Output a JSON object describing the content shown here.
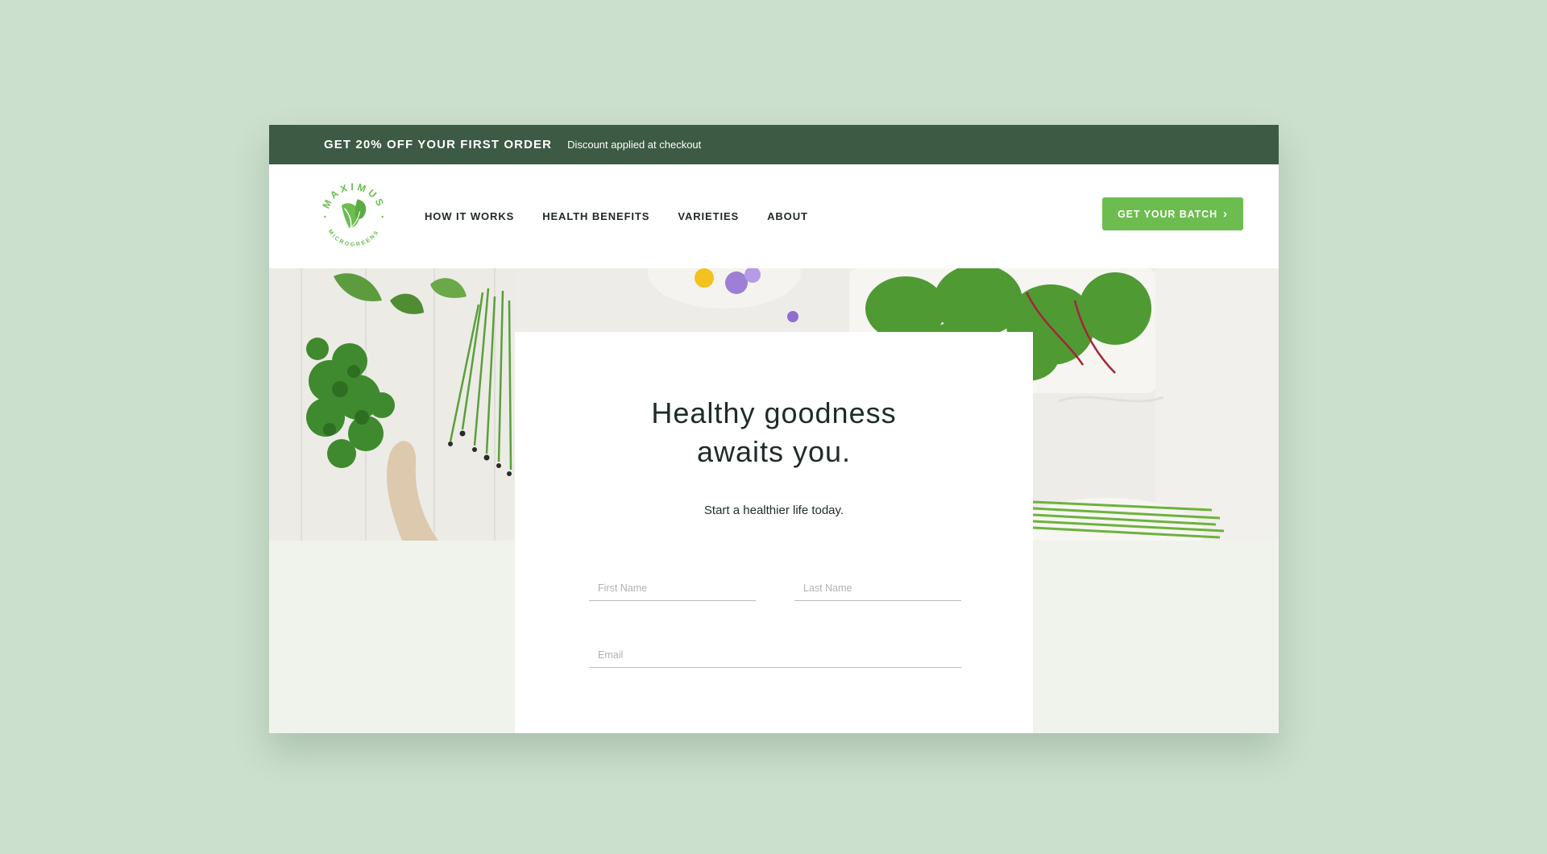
{
  "promo": {
    "headline": "GET 20% OFF YOUR FIRST ORDER",
    "subtext": "Discount applied at checkout"
  },
  "brand": {
    "top_text": "MAXIMUS",
    "bottom_text": "MICROGREENS",
    "color": "#6cbc4f"
  },
  "nav": {
    "items": [
      {
        "label": "HOW IT WORKS"
      },
      {
        "label": "HEALTH BENEFITS"
      },
      {
        "label": "VARIETIES"
      },
      {
        "label": "ABOUT"
      }
    ]
  },
  "cta": {
    "label": "GET YOUR BATCH",
    "chevron": "›"
  },
  "hero_card": {
    "title_line1": "Healthy goodness",
    "title_line2": "awaits you.",
    "subtitle": "Start a healthier life today."
  },
  "form": {
    "first_name_placeholder": "First Name",
    "last_name_placeholder": "Last Name",
    "email_placeholder": "Email"
  },
  "colors": {
    "page_bg": "#cbe0cd",
    "promo_bar": "#3d5a45",
    "accent_green": "#6cbc4f",
    "lower_section": "#eff3ec"
  }
}
